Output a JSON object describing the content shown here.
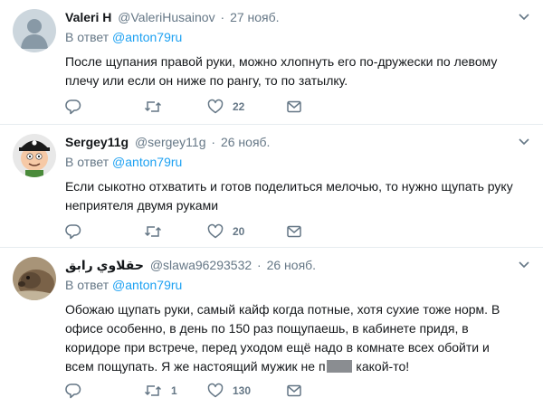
{
  "tweets": [
    {
      "name": "Valeri H",
      "handle": "@ValeriHusainov",
      "dot": "·",
      "date": "27 нояб.",
      "reply_prefix": "В ответ",
      "reply_handle": "@anton79ru",
      "text": "После щупания правой руки, можно хлопнуть его по-дружески по левому плечу или если он ниже по рангу, то по затылку.",
      "replies": "",
      "retweets": "",
      "likes": "22",
      "avatar": "default-avatar"
    },
    {
      "name": "Sergey11g",
      "handle": "@sergey11g",
      "dot": "·",
      "date": "26 нояб.",
      "reply_prefix": "В ответ",
      "reply_handle": "@anton79ru",
      "text": "Если сыкотно отхватить и готов поделиться мелочью, то нужно щупать руку неприятеля двумя руками",
      "replies": "",
      "retweets": "",
      "likes": "20",
      "avatar": "pirate-cartoon-avatar"
    },
    {
      "name": "حقلاوي رابق",
      "handle": "@slawa96293532",
      "dot": "·",
      "date": "26 нояб.",
      "reply_prefix": "В ответ",
      "reply_handle": "@anton79ru",
      "text_before": "Обожаю щупать руки, самый кайф когда потные, хотя сухие тоже норм. В офисе особенно, в день по 150 раз пощупаешь, в кабинете придя, в коридоре при встрече, перед уходом ещё надо в комнате всех обойти и всем пощупать. Я же настоящий мужик не п",
      "text_after": " какой-то!",
      "replies": "",
      "retweets": "1",
      "likes": "130",
      "avatar": "animal-photo-avatar"
    }
  ],
  "colors": {
    "link": "#1da1f2",
    "secondary": "#657786",
    "divider": "#e6ecf0",
    "icon": "#657786"
  }
}
